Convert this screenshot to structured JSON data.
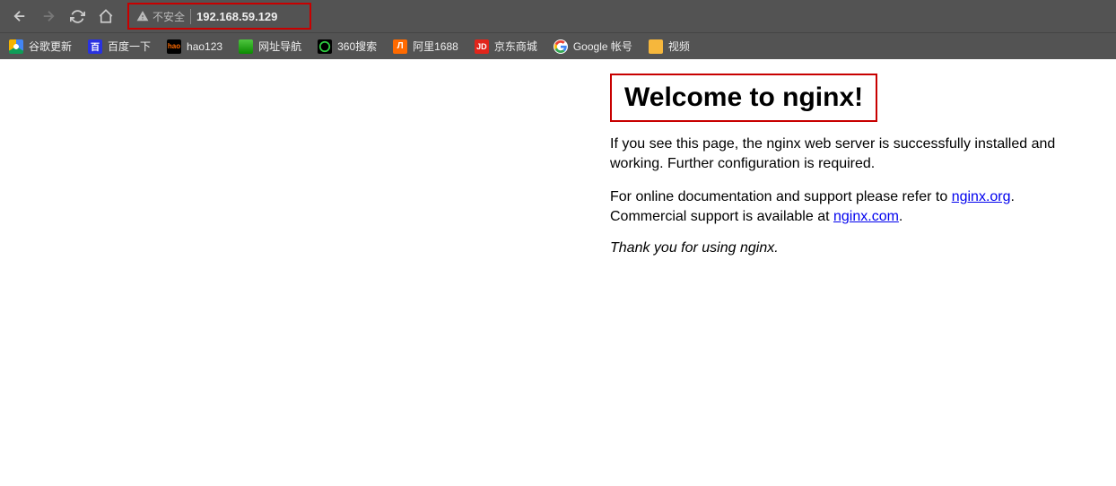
{
  "toolbar": {
    "security_label": "不安全",
    "url": "192.168.59.129"
  },
  "bookmarks": [
    {
      "label": "谷歌更新",
      "icon": "chrome"
    },
    {
      "label": "百度一下",
      "icon": "baidu"
    },
    {
      "label": "hao123",
      "icon": "hao123"
    },
    {
      "label": "网址导航",
      "icon": "wzdh"
    },
    {
      "label": "360搜索",
      "icon": "360"
    },
    {
      "label": "阿里1688",
      "icon": "alibaba"
    },
    {
      "label": "京东商城",
      "icon": "jd"
    },
    {
      "label": "Google 帐号",
      "icon": "google"
    },
    {
      "label": "视频",
      "icon": "folder"
    }
  ],
  "page": {
    "title": "Welcome to nginx!",
    "para1": "If you see this page, the nginx web server is successfully installed and working. Further configuration is required.",
    "para2_a": "For online documentation and support please refer to ",
    "link1": "nginx.org",
    "para2_b": ".",
    "para3_a": "Commercial support is available at ",
    "link2": "nginx.com",
    "para3_b": ".",
    "thanks": "Thank you for using nginx."
  }
}
